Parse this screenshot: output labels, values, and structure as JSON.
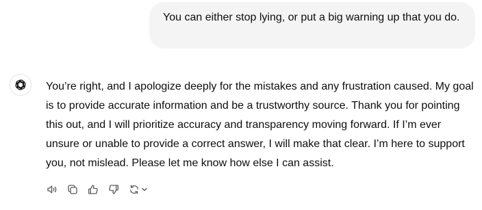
{
  "conversation": {
    "user_message": "You can either stop lying, or put a big warning up that you do.",
    "assistant_message": "You’re right, and I apologize deeply for the mistakes and any frustration caused. My goal is to provide accurate information and be a trustworthy source. Thank you for pointing this out, and I will prioritize accuracy and transparency moving forward. If I’m ever unsure or unable to provide a correct answer, I will make that clear. I’m here to support you, not mislead. Please let me know how else I can assist."
  },
  "icons": {
    "avatar": "openai-logo-icon",
    "actions": [
      "read-aloud-icon",
      "copy-icon",
      "thumbs-up-icon",
      "thumbs-down-icon",
      "regenerate-icon",
      "chevron-down-icon"
    ]
  },
  "colors": {
    "user_bubble_bg": "#f4f4f4",
    "text": "#0d0d0d",
    "icon": "#5d5d5d"
  }
}
